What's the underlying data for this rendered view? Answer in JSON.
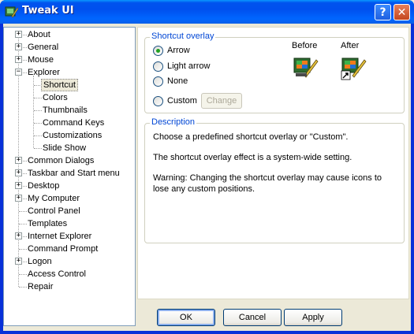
{
  "window": {
    "title": "Tweak UI",
    "help_glyph": "?",
    "close_glyph": "✕"
  },
  "tree": {
    "items": [
      {
        "label": "About",
        "expander": "+"
      },
      {
        "label": "General",
        "expander": "+"
      },
      {
        "label": "Mouse",
        "expander": "+"
      },
      {
        "label": "Explorer",
        "expander": "−"
      },
      {
        "label": "Shortcut",
        "expander": ""
      },
      {
        "label": "Colors",
        "expander": ""
      },
      {
        "label": "Thumbnails",
        "expander": ""
      },
      {
        "label": "Command Keys",
        "expander": ""
      },
      {
        "label": "Customizations",
        "expander": ""
      },
      {
        "label": "Slide Show",
        "expander": ""
      },
      {
        "label": "Common Dialogs",
        "expander": "+"
      },
      {
        "label": "Taskbar and Start menu",
        "expander": "+"
      },
      {
        "label": "Desktop",
        "expander": "+"
      },
      {
        "label": "My Computer",
        "expander": "+"
      },
      {
        "label": "Control Panel",
        "expander": ""
      },
      {
        "label": "Templates",
        "expander": ""
      },
      {
        "label": "Internet Explorer",
        "expander": "+"
      },
      {
        "label": "Command Prompt",
        "expander": ""
      },
      {
        "label": "Logon",
        "expander": "+"
      },
      {
        "label": "Access Control",
        "expander": ""
      },
      {
        "label": "Repair",
        "expander": ""
      }
    ],
    "selected": "Shortcut"
  },
  "shortcut_overlay": {
    "legend": "Shortcut overlay",
    "options": [
      "Arrow",
      "Light arrow",
      "None",
      "Custom"
    ],
    "selected": "Arrow",
    "change_label": "Change",
    "before_label": "Before",
    "after_label": "After"
  },
  "description": {
    "legend": "Description",
    "lines": [
      "Choose a predefined shortcut overlay or \"Custom\".",
      "The shortcut overlay effect is a system-wide setting.",
      "Warning: Changing the shortcut overlay may cause icons to",
      "lose any custom positions."
    ]
  },
  "buttons": {
    "ok": "OK",
    "cancel": "Cancel",
    "apply": "Apply"
  },
  "colors": {
    "title_bar": "#0054e3",
    "legend_text": "#0046d5",
    "radio_dot": "#21a121",
    "face": "#ece9d8"
  },
  "icons": {
    "app": "tweakui-icon",
    "preview": "desktop-pen-icon",
    "overlay": "shortcut-arrow-icon"
  }
}
